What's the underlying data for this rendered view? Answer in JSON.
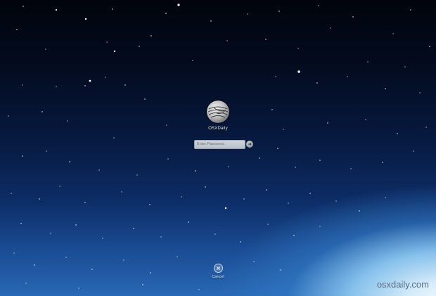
{
  "login": {
    "username": "OSXDaily",
    "password_placeholder": "Enter Password",
    "password_hint_text": "- - - -"
  },
  "cancel": {
    "label": "Cancel"
  },
  "watermark": {
    "text": "osxdaily.com"
  },
  "icons": {
    "avatar": "swirl-globe-avatar-icon",
    "go": "arrow-right-icon",
    "cancel": "close-x-icon"
  },
  "colors": {
    "sky_top": "#01040c",
    "sky_bottom": "#2868b4",
    "horizon_glow": "#d6ecfa"
  }
}
